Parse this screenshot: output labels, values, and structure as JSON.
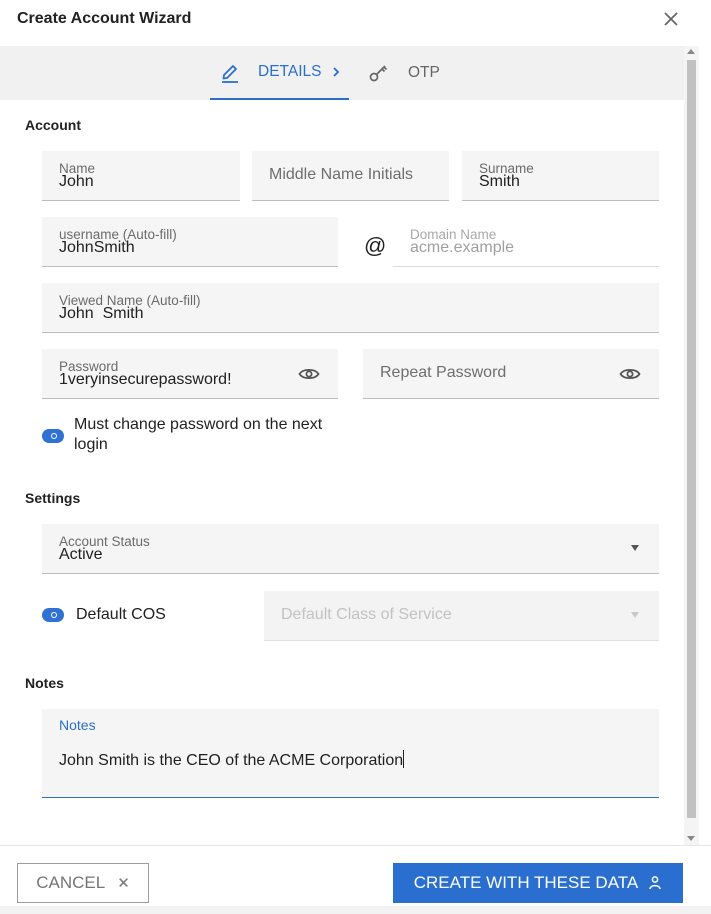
{
  "window": {
    "title": "Create Account Wizard"
  },
  "tabs": [
    {
      "label": "DETAILS",
      "icon": "pencil-icon",
      "active": true
    },
    {
      "label": "OTP",
      "icon": "key-icon",
      "active": false
    }
  ],
  "account": {
    "section_title": "Account",
    "name": {
      "label": "Name",
      "value": "John"
    },
    "middle": {
      "placeholder": "Middle Name Initials"
    },
    "surname": {
      "label": "Surname",
      "value": "Smith"
    },
    "username": {
      "label": "username (Auto-fill)",
      "value": "JohnSmith"
    },
    "at_symbol": "@",
    "domain": {
      "label": "Domain Name",
      "value": "acme.example"
    },
    "viewed_name": {
      "label": "Viewed Name (Auto-fill)",
      "value": "John  Smith"
    },
    "password": {
      "label": "Password",
      "value": "1veryinsecurepassword!"
    },
    "repeat_password": {
      "placeholder": "Repeat Password"
    },
    "must_change": {
      "label_line1": "Must change password on the next",
      "label_line2": "login",
      "checked": true
    }
  },
  "settings": {
    "section_title": "Settings",
    "account_status": {
      "label": "Account Status",
      "value": "Active"
    },
    "default_cos": {
      "label": "Default COS",
      "checked": true
    },
    "class_of_service": {
      "placeholder": "Default Class of Service",
      "disabled": true
    }
  },
  "notes": {
    "section_title": "Notes",
    "label": "Notes",
    "value": "John Smith is the CEO of the ACME Corporation"
  },
  "footer": {
    "cancel_label": "CANCEL",
    "create_label": "CREATE WITH THESE DATA"
  },
  "colors": {
    "accent": "#2a6fd0",
    "field_bg": "#f5f5f5",
    "tab_bar_bg": "#f1f1f1"
  }
}
